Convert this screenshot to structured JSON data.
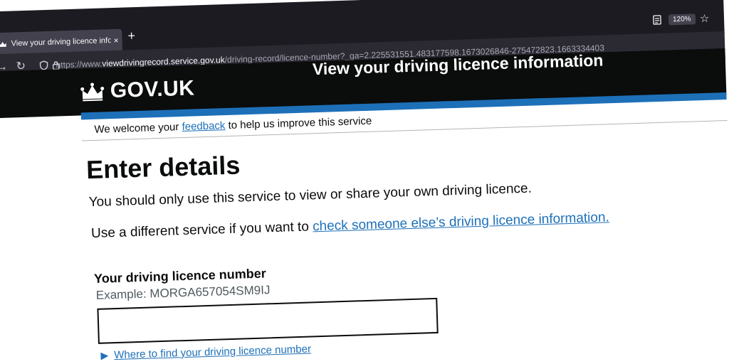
{
  "browser": {
    "tab_title": "View your driving licence inform",
    "tab_close": "×",
    "new_tab": "+",
    "url_prefix": "https://www.",
    "url_domain": "viewdrivingrecord.service.gov.uk",
    "url_path": "/driving-record/licence-number?_ga=2.225531551.483177598.1673026846-275472823.1663334403",
    "zoom": "120%",
    "back": "→",
    "reload": "↻",
    "bookmark": "☆"
  },
  "header": {
    "logo_text": "GOV.UK",
    "service_name": "View your driving licence information"
  },
  "banner": {
    "prefix": "We welcome your ",
    "link": "feedback",
    "suffix": " to help us improve this service"
  },
  "main": {
    "heading": "Enter details",
    "p1": "You should only use this service to view or share your own driving licence.",
    "p2_prefix": "Use a different service if you want to ",
    "p2_link": "check someone else’s driving licence information.",
    "field_label": "Your driving licence number",
    "field_hint": "Example: MORGA657054SM9IJ",
    "field_value": "",
    "details_summary": "Where to find your driving licence number",
    "details_marker": "▶"
  },
  "colors": {
    "link": "#1d70b8",
    "header_bg": "#0b0c0c",
    "accent_bar": "#1d70b8"
  }
}
